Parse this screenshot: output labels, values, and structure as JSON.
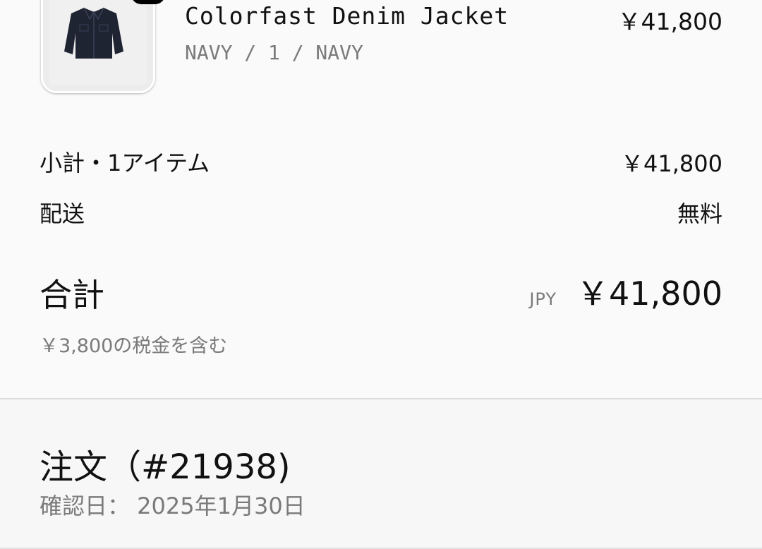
{
  "product": {
    "name": "Colorfast Denim Jacket",
    "variant": "NAVY / 1 / NAVY",
    "price": "￥41,800",
    "image_icon": "denim-jacket-image"
  },
  "summary": {
    "subtotal_label": "小計・1アイテム",
    "subtotal_value": "￥41,800",
    "shipping_label": "配送",
    "shipping_value": "無料",
    "total_label": "合計",
    "total_currency": "JPY",
    "total_value": "￥41,800",
    "tax_note": "￥3,800の税金を含む"
  },
  "order": {
    "title": "注文（#21938)",
    "confirmed_date": "確認日： 2025年1月30日"
  },
  "colors": {
    "background": "#fafafa",
    "text": "#111111",
    "muted_text": "#7a7a7a",
    "divider": "#dcdcdc"
  }
}
